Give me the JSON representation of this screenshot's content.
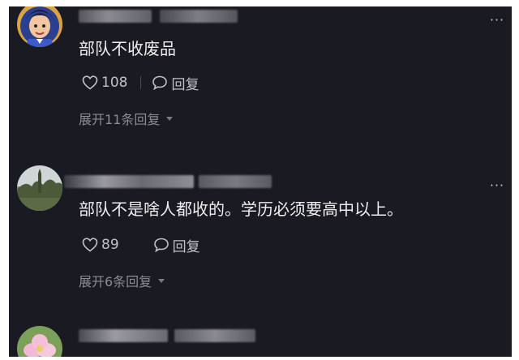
{
  "comments": [
    {
      "text": "部队不收废品",
      "likes": "108",
      "reply_label": "回复",
      "expand_label": "展开11条回复",
      "avatar_icon": "cartoon-character-avatar",
      "more_icon": "more-icon"
    },
    {
      "text": "部队不是啥人都收的。学历必须要高中以上。",
      "likes": "89",
      "reply_label": "回复",
      "expand_label": "展开6条回复",
      "avatar_icon": "landscape-photo-avatar",
      "more_icon": "more-icon"
    },
    {
      "avatar_icon": "flower-photo-avatar"
    }
  ],
  "colors": {
    "background": "#1a1a22",
    "text": "#eeeeef",
    "action": "#c0c0c6",
    "expand": "#8b8b93"
  }
}
